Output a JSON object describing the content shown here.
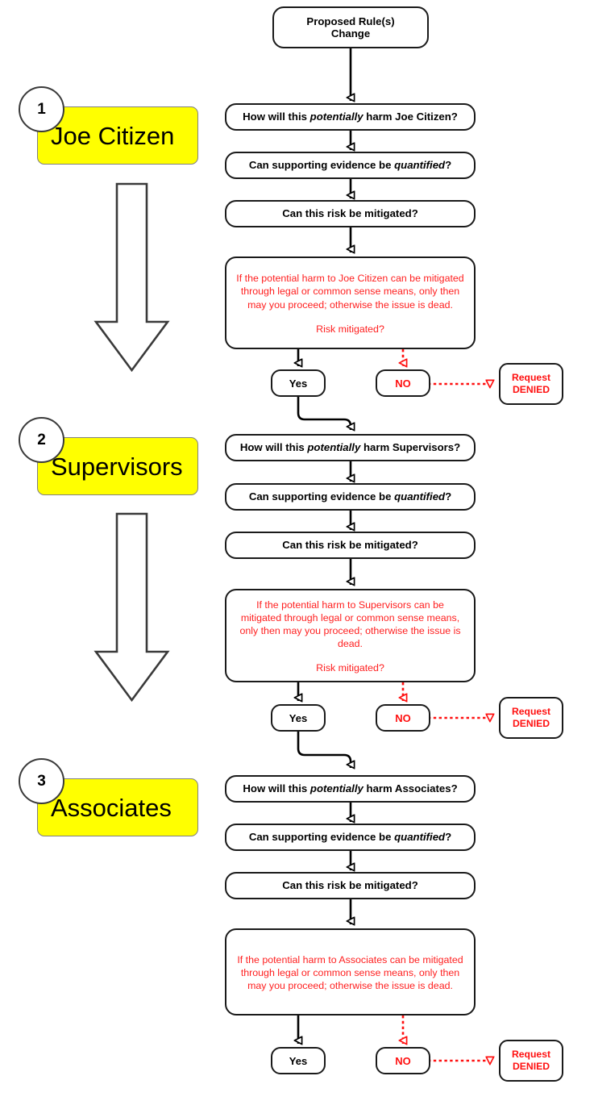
{
  "diagram": {
    "title_box": {
      "line1": "Proposed Rule(s)",
      "line2": "Change"
    },
    "sections": [
      {
        "number": "1",
        "label": "Joe Citizen",
        "q1_pre": "How will this ",
        "q1_em": "potentially",
        "q1_post": " harm Joe Citizen?",
        "q2_pre": "Can supporting evidence be ",
        "q2_em": "quantified",
        "q2_post": "?",
        "q3": "Can this risk be mitigated?",
        "statement": "If the potential harm to Joe Citizen can be mitigated through legal or common sense means, only then may you proceed; otherwise the issue is dead.",
        "statement_question": "Risk mitigated?",
        "yes": "Yes",
        "no": "NO",
        "denied_line1": "Request",
        "denied_line2": "DENIED"
      },
      {
        "number": "2",
        "label": "Supervisors",
        "q1_pre": "How will this ",
        "q1_em": "potentially",
        "q1_post": " harm Supervisors?",
        "q2_pre": "Can supporting evidence be ",
        "q2_em": "quantified",
        "q2_post": "?",
        "q3": "Can this risk be mitigated?",
        "statement": "If the potential harm to Supervisors can be mitigated through legal or common sense means, only then may you proceed; otherwise the issue is dead.",
        "statement_question": "Risk mitigated?",
        "yes": "Yes",
        "no": "NO",
        "denied_line1": "Request",
        "denied_line2": "DENIED"
      },
      {
        "number": "3",
        "label": "Associates",
        "q1_pre": "How will this ",
        "q1_em": "potentially",
        "q1_post": " harm Associates?",
        "q2_pre": "Can supporting evidence be ",
        "q2_em": "quantified",
        "q2_post": "?",
        "q3": "Can this risk be mitigated?",
        "statement": "If the potential harm to Associates can be mitigated through legal or common sense means, only then may you proceed; otherwise the issue is dead.",
        "statement_question": "",
        "yes": "Yes",
        "no": "NO",
        "denied_line1": "Request",
        "denied_line2": "DENIED"
      }
    ],
    "colors": {
      "highlight": "#ffff00",
      "negative": "#ff1010",
      "statement": "#ff2020",
      "outline": "#1a1a1a",
      "big_arrow_outline": "#3a3a3a"
    },
    "icons": {
      "big_down_arrow": "down-arrow-block",
      "flow_arrow": "arrowhead-hollow",
      "reject_arrow": "arrowhead-red-dotted"
    }
  }
}
